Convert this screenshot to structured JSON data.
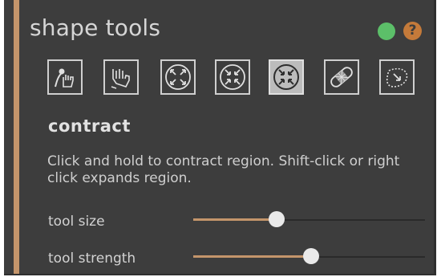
{
  "panel": {
    "title": "shape tools",
    "status_indicator": "green-status-dot",
    "help": {
      "label": "?",
      "icon": "question-mark-icon"
    }
  },
  "toolbar": {
    "tools": [
      {
        "icon": "push-hand-icon",
        "selected": false
      },
      {
        "icon": "drag-hand-icon",
        "selected": false
      },
      {
        "icon": "expand-region-icon",
        "selected": false
      },
      {
        "icon": "contract-region-icon",
        "selected": false
      },
      {
        "icon": "contract-region-selected-icon",
        "selected": true
      },
      {
        "icon": "bandage-heal-icon",
        "selected": false
      },
      {
        "icon": "smooth-curve-icon",
        "selected": false
      }
    ]
  },
  "current_tool": {
    "name": "contract",
    "description": "Click and hold to contract region.  Shift-click or right click expands region."
  },
  "sliders": [
    {
      "label": "tool size",
      "value": 0.36
    },
    {
      "label": "tool strength",
      "value": 0.51
    }
  ],
  "colors": {
    "panel_bg": "#3d3d3d",
    "accent": "#c4956b",
    "status_green": "#5cbf69",
    "help_orange": "#c47a3a"
  }
}
